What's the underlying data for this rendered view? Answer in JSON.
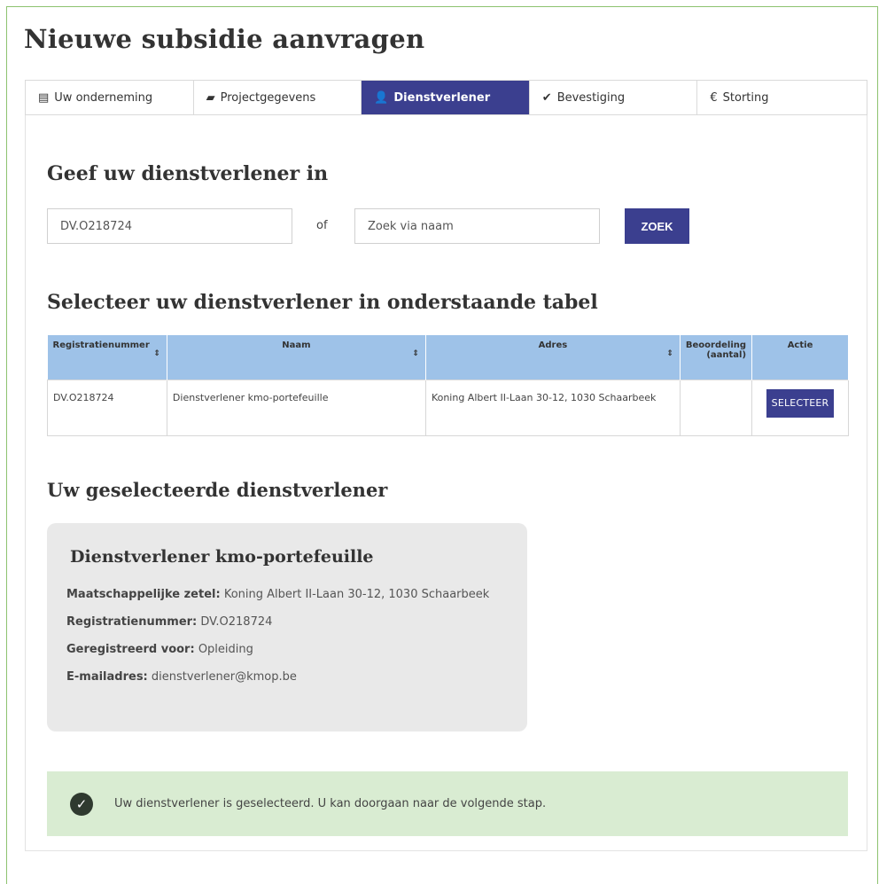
{
  "page": {
    "title": "Nieuwe subsidie aanvragen"
  },
  "tabs": [
    {
      "label": "Uw onderneming",
      "icon": "building-icon",
      "glyph": "▤"
    },
    {
      "label": "Projectgegevens",
      "icon": "folder-icon",
      "glyph": "▰"
    },
    {
      "label": "Dienstverlener",
      "icon": "user-icon",
      "glyph": "👤"
    },
    {
      "label": "Bevestiging",
      "icon": "check-circle-icon",
      "glyph": "✔"
    },
    {
      "label": "Storting",
      "icon": "euro-icon",
      "glyph": "€"
    }
  ],
  "active_tab": "Dienstverlener",
  "search": {
    "heading": "Geef uw dienstverlener in",
    "id_value": "DV.O218724",
    "or_label": "of",
    "name_placeholder": "Zoek via naam",
    "button_label": "ZOEK"
  },
  "table": {
    "heading": "Selecteer uw dienstverlener in onderstaande tabel",
    "columns": [
      "Registratienummer",
      "Naam",
      "Adres",
      "Beoordeling (aantal)",
      "Actie"
    ],
    "rows": [
      {
        "registratienummer": "DV.O218724",
        "naam": "Dienstverlener kmo-portefeuille",
        "adres": "Koning Albert II-Laan 30-12, 1030 Schaarbeek",
        "beoordeling": "",
        "actie": "SELECTEER"
      }
    ]
  },
  "selected": {
    "heading": "Uw geselecteerde dienstverlener",
    "name": "Dienstverlener kmo-portefeuille",
    "fields": [
      {
        "label": "Maatschappelijke zetel:",
        "value": "Koning Albert II-Laan 30-12, 1030 Schaarbeek"
      },
      {
        "label": "Registratienummer:",
        "value": "DV.O218724"
      },
      {
        "label": "Geregistreerd voor:",
        "value": "Opleiding"
      },
      {
        "label": "E-mailadres:",
        "value": "dienstverlener@kmop.be"
      }
    ]
  },
  "alert": {
    "message": "Uw dienstverlener is geselecteerd. U kan doorgaan naar de volgende stap.",
    "icon": "check-circle-icon",
    "color": "#d9ecd2"
  },
  "colors": {
    "primary": "#3b3f8f",
    "table_header": "#9ec2e8",
    "frame_border": "#8dc26f"
  }
}
